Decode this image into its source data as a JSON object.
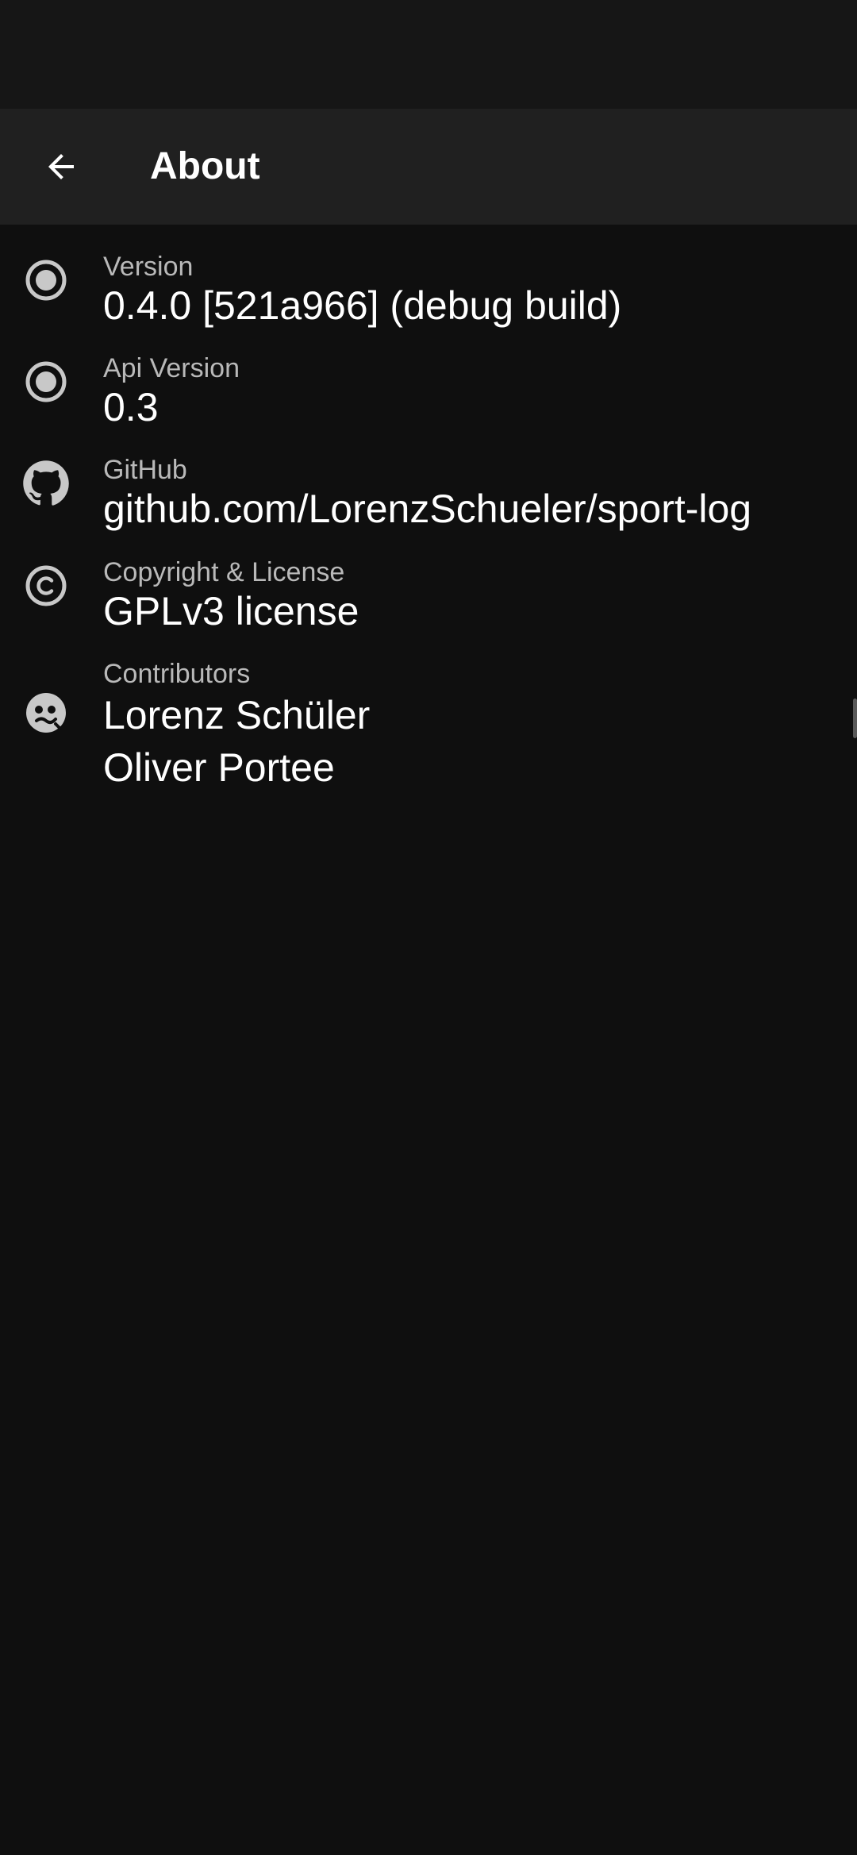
{
  "app_bar": {
    "title": "About",
    "back_icon": "arrow-left-icon"
  },
  "items": [
    {
      "icon": "radio-button-checked-icon",
      "label": "Version",
      "value": "0.4.0 [521a966] (debug build)"
    },
    {
      "icon": "radio-button-checked-icon",
      "label": "Api Version",
      "value": "0.3"
    },
    {
      "icon": "github-icon",
      "label": "GitHub",
      "value": "github.com/LorenzSchueler/sport-log"
    },
    {
      "icon": "copyright-icon",
      "label": "Copyright & License",
      "value": "GPLv3 license"
    },
    {
      "icon": "contributors-face-icon",
      "label": "Contributors",
      "values": [
        "Lorenz Schüler",
        "Oliver Portee"
      ]
    }
  ],
  "colors": {
    "background": "#0f0f0f",
    "app_bar": "#202020",
    "status_bar": "#161616",
    "label": "#b9b9b9",
    "value": "#ffffff",
    "icon": "#c8c8c8"
  }
}
